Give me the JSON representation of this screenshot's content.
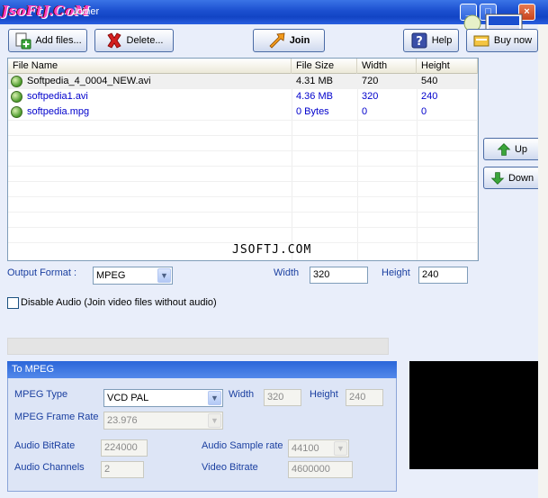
{
  "window": {
    "logo_text": "JsoFtJ.CoM",
    "title": "... Joiner"
  },
  "toolbar": {
    "add_files": "Add files...",
    "delete": "Delete...",
    "join": "Join",
    "help": "Help",
    "buy_now": "Buy now"
  },
  "file_list": {
    "columns": [
      "File Name",
      "File Size",
      "Width",
      "Height"
    ],
    "rows": [
      {
        "name": "Softpedia_4_0004_NEW.avi",
        "size": "4.31 MB",
        "width": "720",
        "height": "540"
      },
      {
        "name": "softpedia1.avi",
        "size": "4.36 MB",
        "width": "320",
        "height": "240"
      },
      {
        "name": "softpedia.mpg",
        "size": "0 Bytes",
        "width": "0",
        "height": "0"
      }
    ],
    "watermark": "JSOFTJ.COM"
  },
  "side_buttons": {
    "up": "Up",
    "down": "Down"
  },
  "output": {
    "format_label": "Output Format :",
    "format_value": "MPEG",
    "width_label": "Width",
    "width_value": "320",
    "height_label": "Height",
    "height_value": "240",
    "disable_audio_label": "Disable Audio (Join video files without audio)"
  },
  "mpeg_group": {
    "title": "To MPEG",
    "type_label": "MPEG Type",
    "type_value": "VCD PAL",
    "width_label": "Width",
    "width_value": "320",
    "height_label": "Height",
    "height_value": "240",
    "frame_rate_label": "MPEG Frame Rate",
    "frame_rate_value": "23.976",
    "audio_bitrate_label": "Audio BitRate",
    "audio_bitrate_value": "224000",
    "audio_sample_rate_label": "Audio Sample rate",
    "audio_sample_rate_value": "44100",
    "audio_channels_label": "Audio Channels",
    "audio_channels_value": "2",
    "video_bitrate_label": "Video Bitrate",
    "video_bitrate_value": "4600000"
  }
}
